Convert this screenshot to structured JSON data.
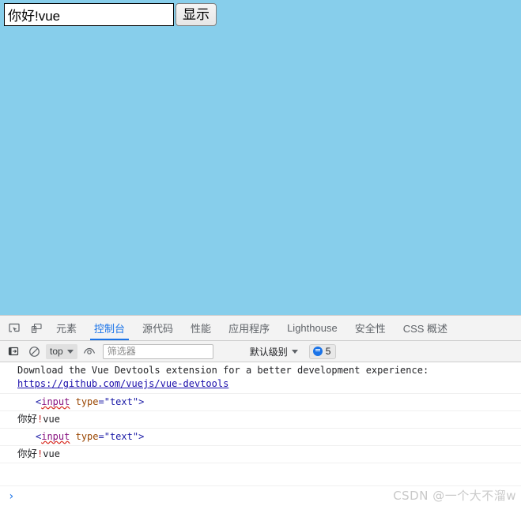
{
  "page": {
    "background_color": "#87CEEB",
    "input": {
      "value": "你好!vue",
      "placeholder": ""
    },
    "show_button_label": "显示"
  },
  "devtools": {
    "tabs": [
      {
        "label": "元素",
        "active": false
      },
      {
        "label": "控制台",
        "active": true
      },
      {
        "label": "源代码",
        "active": false
      },
      {
        "label": "性能",
        "active": false
      },
      {
        "label": "应用程序",
        "active": false
      },
      {
        "label": "Lighthouse",
        "active": false
      },
      {
        "label": "安全性",
        "active": false
      },
      {
        "label": "CSS 概述",
        "active": false
      }
    ],
    "active_tab": "控制台",
    "accent_color": "#1a73e8",
    "toolbar": {
      "context_value": "top",
      "filter_placeholder": "筛选器",
      "filter_value": "",
      "level_value": "默认级别",
      "message_count": "5"
    },
    "console": {
      "messages": [
        {
          "type": "log-link",
          "text": "Download the Vue Devtools extension for a better development experience:",
          "link": "https://github.com/vuejs/vue-devtools"
        },
        {
          "type": "node",
          "punct_open": "<",
          "tag": "input",
          "space": " ",
          "attr": "type",
          "eq": "=",
          "value": "\"text\"",
          "punct_close": ">"
        },
        {
          "type": "text",
          "before": "你好",
          "bang": "!",
          "after": "vue"
        },
        {
          "type": "node",
          "punct_open": "<",
          "tag": "input",
          "space": " ",
          "attr": "type",
          "eq": "=",
          "value": "\"text\"",
          "punct_close": ">"
        },
        {
          "type": "text",
          "before": "你好",
          "bang": "!",
          "after": "vue"
        }
      ],
      "prompt_caret": "›"
    }
  },
  "watermark": "CSDN @一个大不溜w"
}
